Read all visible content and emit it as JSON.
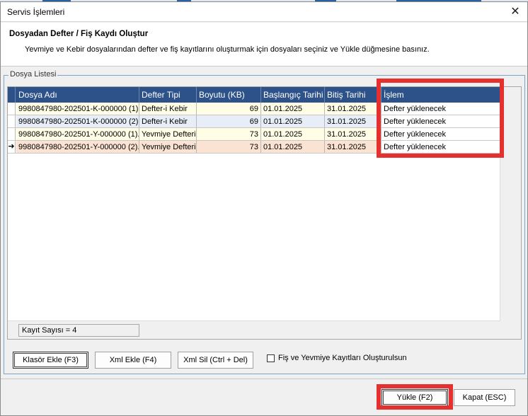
{
  "window": {
    "title": "Servis İşlemleri",
    "close_glyph": "✕"
  },
  "header": {
    "title": "Dosyadan Defter / Fiş Kaydı Oluştur",
    "description": "Yevmiye ve Kebir dosyalarından defter ve fiş kayıtlarını oluşturmak için dosyaları seçiniz ve Yükle düğmesine basınız."
  },
  "file_list": {
    "legend": "Dosya Listesi",
    "columns": [
      "Dosya Adı",
      "Defter Tipi",
      "Boyutu (KB)",
      "Başlangıç Tarihi",
      "Bitiş Tarihi",
      "İşlem"
    ],
    "rows": [
      {
        "name": "9980847980-202501-K-000000 (1).",
        "type": "Defter-i Kebir",
        "size": "69",
        "start": "01.01.2025",
        "end": "31.01.2025",
        "action": "Defter yüklenecek",
        "bg": "#fffde6"
      },
      {
        "name": "9980847980-202501-K-000000 (2).",
        "type": "Defter-i Kebir",
        "size": "69",
        "start": "01.01.2025",
        "end": "31.01.2025",
        "action": "Defter yüklenecek",
        "bg": "#e8eef7"
      },
      {
        "name": "9980847980-202501-Y-000000 (1).",
        "type": "Yevmiye Defteri",
        "size": "73",
        "start": "01.01.2025",
        "end": "31.01.2025",
        "action": "Defter yüklenecek",
        "bg": "#fffde6"
      },
      {
        "name": "9980847980-202501-Y-000000 (2).",
        "type": "Yevmiye Defteri",
        "size": "73",
        "start": "01.01.2025",
        "end": "31.01.2025",
        "action": "Defter yüklenecek",
        "bg": "#fbe3d3",
        "current": true
      }
    ],
    "row_indicator": "➜",
    "record_count": "Kayıt Sayısı = 4"
  },
  "toolbar": {
    "add_folder": "Klasör Ekle (F3)",
    "add_xml": "Xml Ekle (F4)",
    "delete_xml": "Xml Sil (Ctrl + Del)",
    "create_records_checkbox": "Fiş ve Yevmiye Kayıtları Oluşturulsun",
    "create_records_checked": false
  },
  "actions": {
    "load": "Yükle (F2)",
    "close": "Kapat (ESC)"
  },
  "colors": {
    "grid_header": "#2d5289",
    "highlight": "#e53030"
  }
}
